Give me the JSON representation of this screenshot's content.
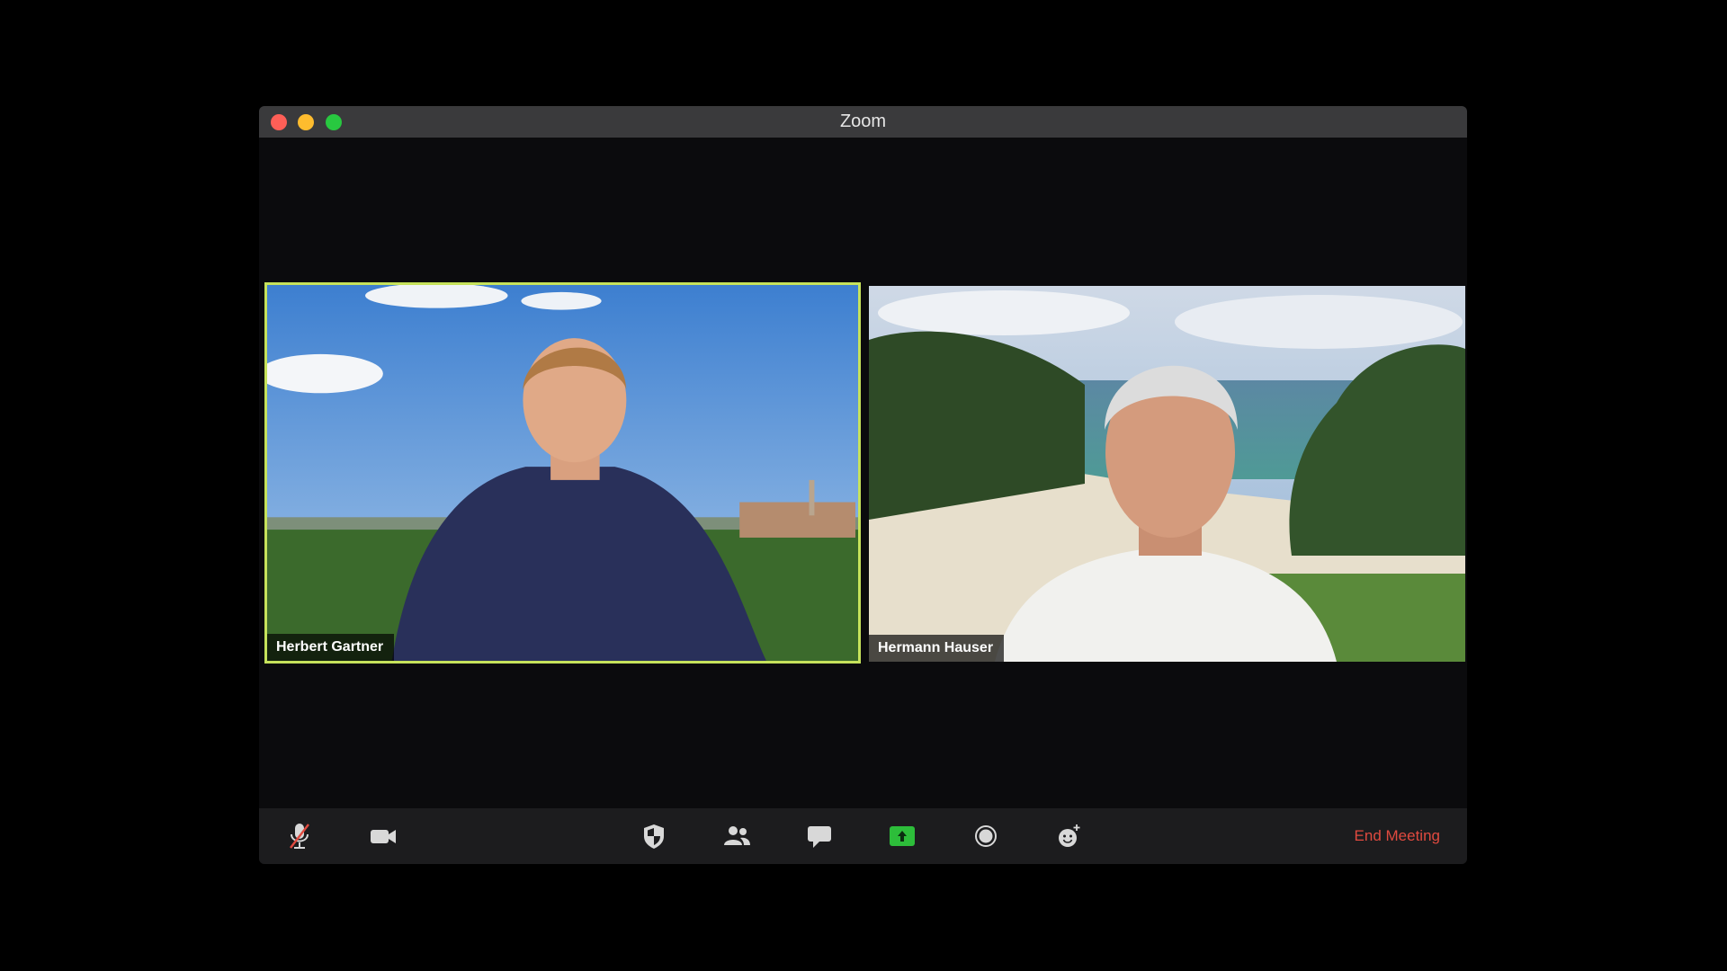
{
  "window": {
    "title": "Zoom"
  },
  "participants": [
    {
      "name": "Herbert Gartner",
      "active_speaker": true
    },
    {
      "name": "Hermann Hauser",
      "active_speaker": false
    }
  ],
  "toolbar": {
    "items": [
      {
        "icon": "microphone-muted-icon"
      },
      {
        "icon": "video-camera-icon"
      },
      {
        "icon": "security-shield-icon"
      },
      {
        "icon": "participants-icon"
      },
      {
        "icon": "chat-icon"
      },
      {
        "icon": "share-screen-icon"
      },
      {
        "icon": "record-icon"
      },
      {
        "icon": "reactions-icon"
      }
    ],
    "end_label": "End Meeting"
  },
  "colors": {
    "active_speaker_border": "#c6e25b",
    "end_meeting": "#e04a3f",
    "share_button": "#2dbd3a"
  }
}
